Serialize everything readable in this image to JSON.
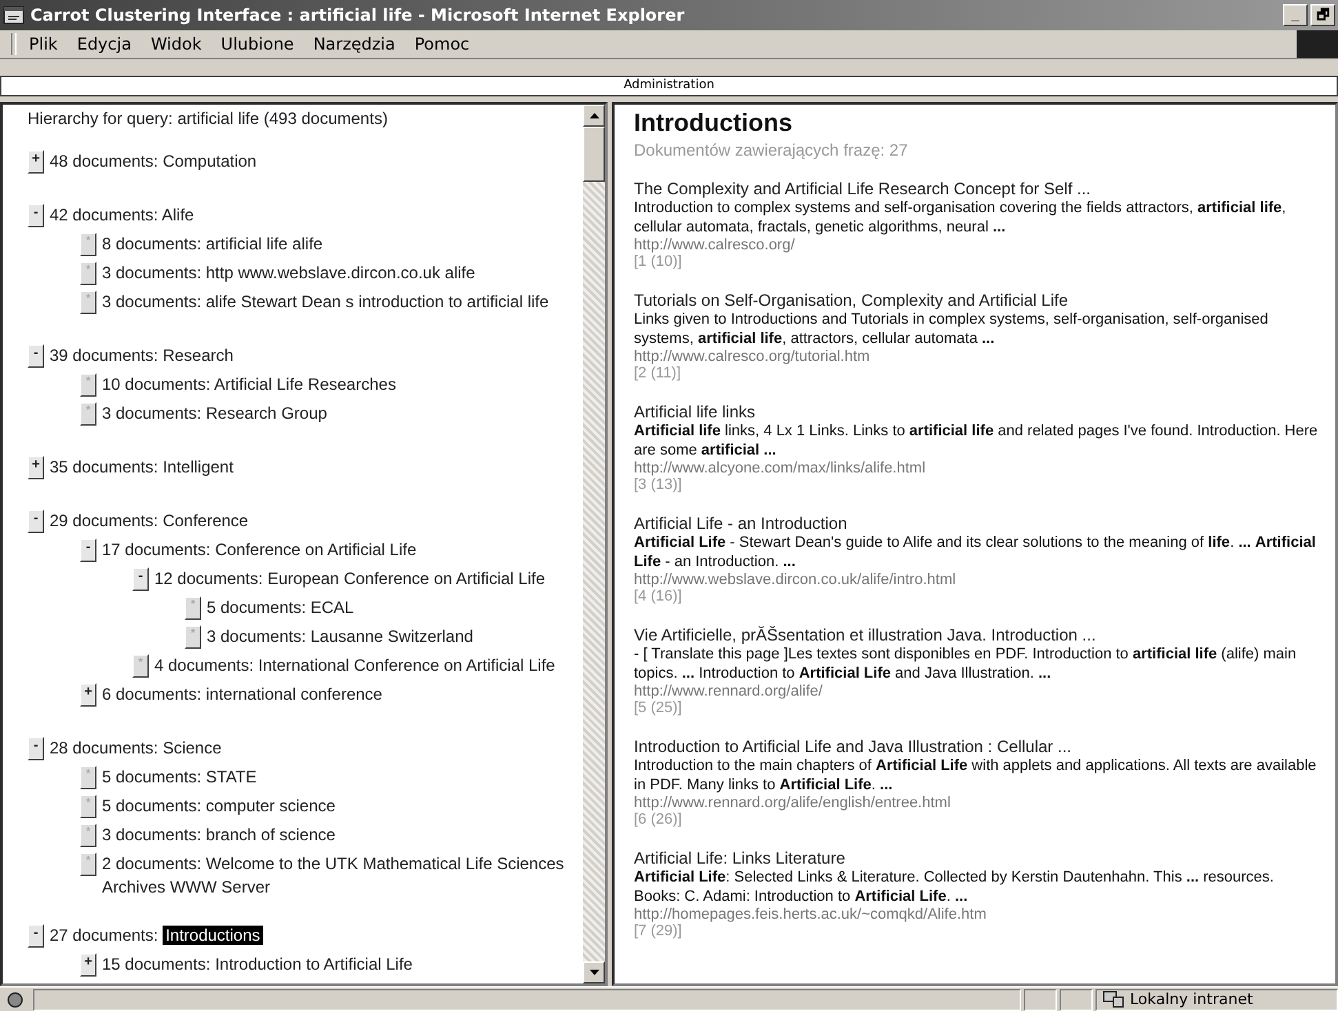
{
  "window": {
    "title": "Carrot Clustering Interface : artificial life - Microsoft Internet Explorer",
    "controls": [
      "_",
      "🗗"
    ]
  },
  "menu": [
    {
      "label": "Plik"
    },
    {
      "label": "Edycja"
    },
    {
      "label": "Widok"
    },
    {
      "label": "Ulubione"
    },
    {
      "label": "Narzędzia"
    },
    {
      "label": "Pomoc"
    }
  ],
  "top_frame": {
    "label": "Administration"
  },
  "tree": {
    "header": "Hierarchy for query: artificial life (493 documents)",
    "nodes": [
      {
        "toggle": "+",
        "kind": "branch",
        "count": "48 documents:",
        "label": "Computation",
        "selected": false
      },
      {
        "toggle": "-",
        "kind": "branch",
        "count": "42 documents:",
        "label": "Alife",
        "selected": false,
        "children": [
          {
            "toggle": "*",
            "kind": "leaf",
            "count": "8 documents:",
            "label": "artificial life alife",
            "selected": false
          },
          {
            "toggle": "*",
            "kind": "leaf",
            "count": "3 documents:",
            "label": "http www.webslave.dircon.co.uk alife",
            "selected": false
          },
          {
            "toggle": "*",
            "kind": "leaf",
            "count": "3 documents:",
            "label": "alife Stewart Dean s introduction to artificial life",
            "selected": false
          }
        ]
      },
      {
        "toggle": "-",
        "kind": "branch",
        "count": "39 documents:",
        "label": "Research",
        "selected": false,
        "children": [
          {
            "toggle": "*",
            "kind": "leaf",
            "count": "10 documents:",
            "label": "Artificial Life Researches",
            "selected": false
          },
          {
            "toggle": "*",
            "kind": "leaf",
            "count": "3 documents:",
            "label": "Research Group",
            "selected": false
          }
        ]
      },
      {
        "toggle": "+",
        "kind": "branch",
        "count": "35 documents:",
        "label": "Intelligent",
        "selected": false
      },
      {
        "toggle": "-",
        "kind": "branch",
        "count": "29 documents:",
        "label": "Conference",
        "selected": false,
        "children": [
          {
            "toggle": "-",
            "kind": "branch",
            "count": "17 documents:",
            "label": "Conference on Artificial Life",
            "selected": false,
            "children": [
              {
                "toggle": "-",
                "kind": "branch",
                "count": "12 documents:",
                "label": "European Conference on Artificial Life",
                "selected": false,
                "children": [
                  {
                    "toggle": "*",
                    "kind": "leaf",
                    "count": "5 documents:",
                    "label": "ECAL",
                    "selected": false
                  },
                  {
                    "toggle": "*",
                    "kind": "leaf",
                    "count": "3 documents:",
                    "label": "Lausanne Switzerland",
                    "selected": false
                  }
                ]
              },
              {
                "toggle": "*",
                "kind": "leaf",
                "count": "4 documents:",
                "label": "International Conference on Artificial Life",
                "selected": false
              }
            ]
          },
          {
            "toggle": "+",
            "kind": "branch",
            "count": "6 documents:",
            "label": "international conference",
            "selected": false
          }
        ]
      },
      {
        "toggle": "-",
        "kind": "branch",
        "count": "28 documents:",
        "label": "Science",
        "selected": false,
        "children": [
          {
            "toggle": "*",
            "kind": "leaf",
            "count": "5 documents:",
            "label": "STATE",
            "selected": false
          },
          {
            "toggle": "*",
            "kind": "leaf",
            "count": "5 documents:",
            "label": "computer science",
            "selected": false
          },
          {
            "toggle": "*",
            "kind": "leaf",
            "count": "3 documents:",
            "label": "branch of science",
            "selected": false
          },
          {
            "toggle": "*",
            "kind": "leaf",
            "count": "2 documents:",
            "label": "Welcome to the UTK Mathematical Life Sciences Archives WWW Server",
            "selected": false
          }
        ]
      },
      {
        "toggle": "-",
        "kind": "branch",
        "count": "27 documents:",
        "label": "Introductions",
        "selected": true,
        "children": [
          {
            "toggle": "+",
            "kind": "branch",
            "count": "15 documents:",
            "label": "Introduction to Artificial Life",
            "selected": false
          }
        ]
      }
    ]
  },
  "results": {
    "title": "Introductions",
    "subtitle": "Dokumentów zawierających frazę: 27",
    "items": [
      {
        "title": "The Complexity and Artificial Life Research Concept for Self ...",
        "snippet": "Introduction to complex systems and self-organisation covering the fields attractors, **artificial life**, cellular automata, fractals, genetic algorithms, neural **...**",
        "url": "http://www.calresco.org/",
        "rank": "[1 (10)]"
      },
      {
        "title": "Tutorials on Self-Organisation, Complexity and Artificial Life",
        "snippet": "Links given to Introductions and Tutorials in complex systems, self-organisation, self-organised systems, **artificial life**, attractors, cellular automata **...**",
        "url": "http://www.calresco.org/tutorial.htm",
        "rank": "[2 (11)]"
      },
      {
        "title": "Artificial life links",
        "snippet": "**Artificial life** links, 4 Lx 1 Links. Links to **artificial life** and related pages I've found. Introduction. Here are some **artificial ...**",
        "url": "http://www.alcyone.com/max/links/alife.html",
        "rank": "[3 (13)]"
      },
      {
        "title": "Artificial Life - an Introduction",
        "snippet": "**Artificial Life** - Stewart Dean's guide to Alife and its clear solutions to the meaning of **life**. **...** **Artificial Life** - an Introduction. **...**",
        "url": "http://www.webslave.dircon.co.uk/alife/intro.html",
        "rank": "[4 (16)]"
      },
      {
        "title": "Vie Artificielle, prĂŠsentation et illustration Java. Introduction ...",
        "snippet": "- [ Translate this page ]Les textes sont disponibles en PDF. Introduction to **artificial life** (alife) main topics. **...** Introduction to **Artificial Life** and Java Illustration. **...**",
        "url": "http://www.rennard.org/alife/",
        "rank": "[5 (25)]"
      },
      {
        "title": "Introduction to Artificial Life and Java Illustration : Cellular ...",
        "snippet": "Introduction to the main chapters of **Artificial Life** with applets and applications. All texts are available in PDF. Many links to **Artificial Life**. **...**",
        "url": "http://www.rennard.org/alife/english/entree.html",
        "rank": "[6 (26)]"
      },
      {
        "title": "Artificial Life: Links Literature",
        "snippet": "**Artificial Life**: Selected Links & Literature. Collected by Kerstin Dautenhahn. This **...** resources. Books: C. Adami: Introduction to **Artificial Life**. **...**",
        "url": "http://homepages.feis.herts.ac.uk/~comqkd/Alife.htm",
        "rank": "[7 (29)]"
      }
    ]
  },
  "status_bar": {
    "zone": "Lokalny intranet"
  }
}
